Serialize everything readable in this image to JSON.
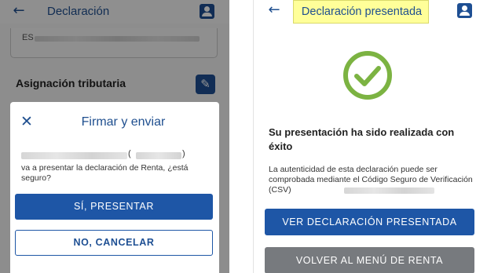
{
  "left": {
    "header": {
      "title": "Declaración",
      "back_icon": "arrow-left-icon",
      "user_icon": "user-icon"
    },
    "field": {
      "prefix": "ES"
    },
    "section": {
      "title": "Asignación tributaria",
      "edit_icon": "pencil-icon"
    },
    "dialog": {
      "title": "Firmar y enviar",
      "close_icon": "close-icon",
      "paren_open": "(",
      "paren_close": ")",
      "message": "va a presentar la declaración de Renta, ¿está seguro?",
      "confirm_label": "SÍ, PRESENTAR",
      "cancel_label": "NO, CANCELAR"
    }
  },
  "right": {
    "header": {
      "title": "Declaración presentada",
      "back_icon": "arrow-left-icon",
      "user_icon": "user-icon"
    },
    "status_icon": "check-circle-icon",
    "status_title": "Su presentación ha sido realizada con éxito",
    "info_text": "La autenticidad de esta declaración puede ser comprobada mediante el Código Seguro de Verificación (CSV)",
    "view_label": "VER DECLARACIÓN PRESENTADA",
    "back_label": "VOLVER AL MENÚ DE RENTA"
  },
  "colors": {
    "primary": "#1e56a6",
    "secondary_button": "#777a7e",
    "success": "#7cb342",
    "title_highlight": "#ffff99"
  }
}
